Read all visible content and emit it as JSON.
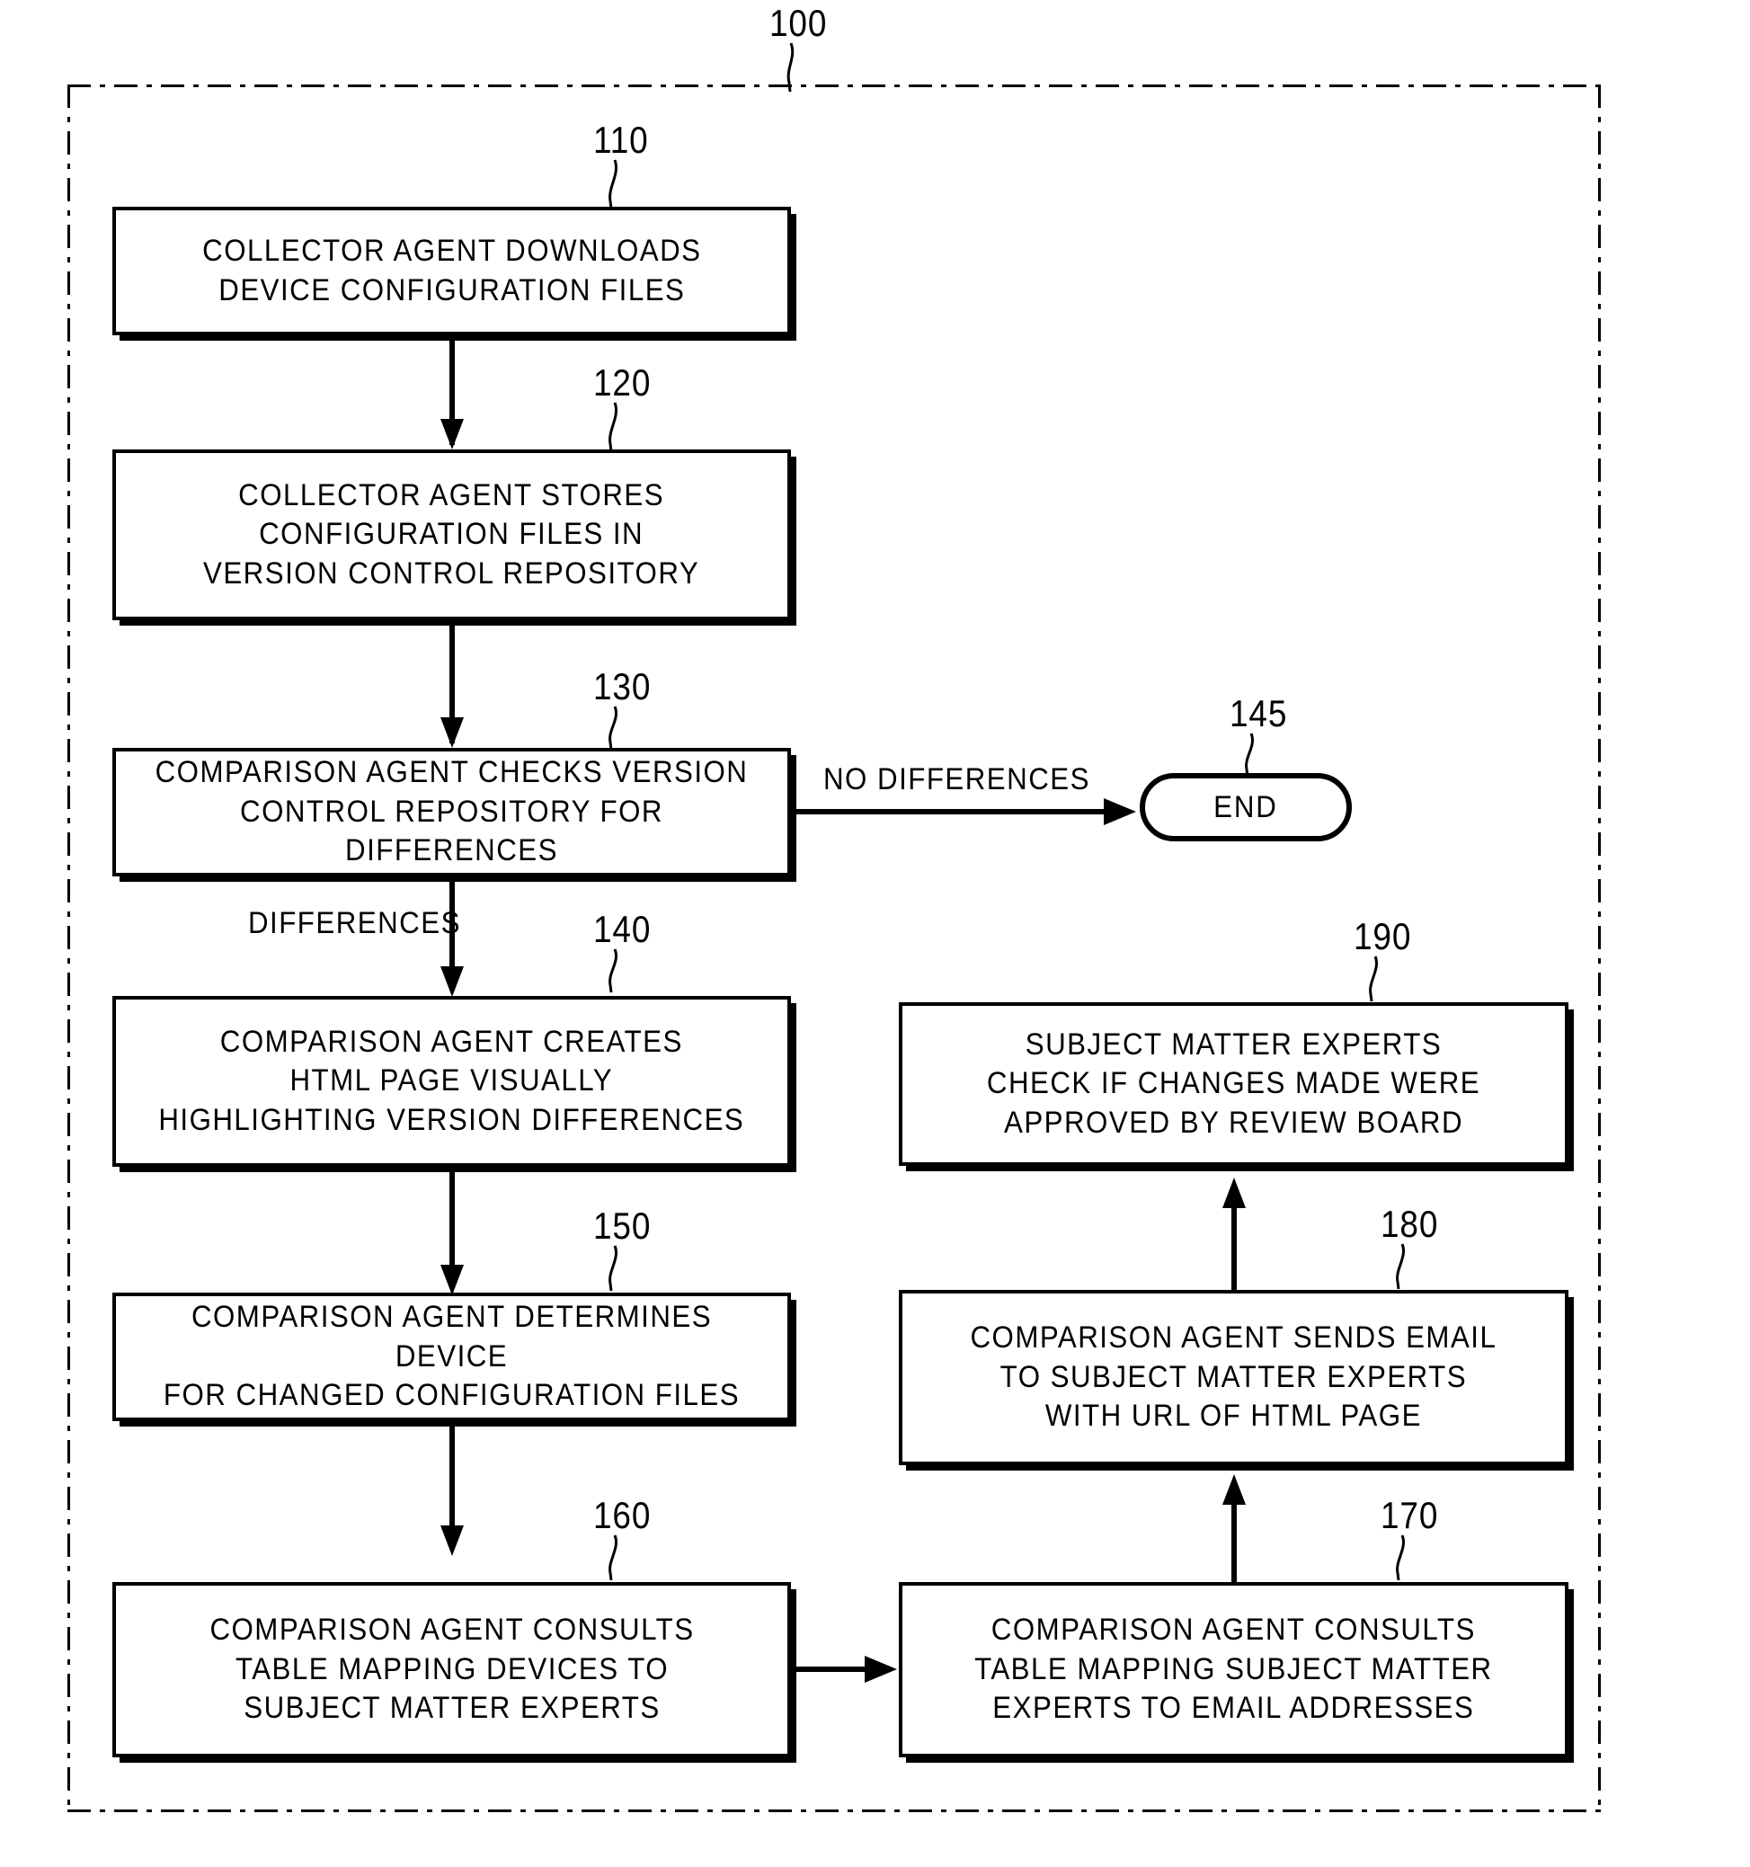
{
  "figure": {
    "system_ref": "100",
    "boundary_style": "dash-dot rectangle"
  },
  "nodes": [
    {
      "id": "110",
      "ref": "110",
      "shape": "process",
      "text": "COLLECTOR AGENT DOWNLOADS\nDEVICE CONFIGURATION FILES"
    },
    {
      "id": "120",
      "ref": "120",
      "shape": "process",
      "text": "COLLECTOR AGENT STORES\nCONFIGURATION FILES IN\nVERSION CONTROL REPOSITORY"
    },
    {
      "id": "130",
      "ref": "130",
      "shape": "process",
      "text": "COMPARISON AGENT CHECKS VERSION\nCONTROL REPOSITORY FOR DIFFERENCES"
    },
    {
      "id": "140",
      "ref": "140",
      "shape": "process",
      "text": "COMPARISON AGENT CREATES\nHTML PAGE VISUALLY\nHIGHLIGHTING VERSION DIFFERENCES"
    },
    {
      "id": "145",
      "ref": "145",
      "shape": "terminator",
      "text": "END"
    },
    {
      "id": "150",
      "ref": "150",
      "shape": "process",
      "text": "COMPARISON AGENT DETERMINES DEVICE\nFOR CHANGED CONFIGURATION FILES"
    },
    {
      "id": "160",
      "ref": "160",
      "shape": "process",
      "text": "COMPARISON AGENT CONSULTS\nTABLE MAPPING DEVICES TO\nSUBJECT MATTER EXPERTS"
    },
    {
      "id": "170",
      "ref": "170",
      "shape": "process",
      "text": "COMPARISON AGENT CONSULTS\nTABLE MAPPING SUBJECT MATTER\nEXPERTS TO EMAIL ADDRESSES"
    },
    {
      "id": "180",
      "ref": "180",
      "shape": "process",
      "text": "COMPARISON AGENT SENDS EMAIL\nTO SUBJECT MATTER EXPERTS\nWITH URL OF HTML PAGE"
    },
    {
      "id": "190",
      "ref": "190",
      "shape": "process",
      "text": "SUBJECT MATTER EXPERTS\nCHECK IF CHANGES MADE WERE\nAPPROVED BY REVIEW BOARD"
    }
  ],
  "edge_labels": {
    "no_differences": "NO DIFFERENCES",
    "differences": "DIFFERENCES"
  },
  "colors": {
    "ink": "#000000",
    "paper": "#ffffff"
  }
}
